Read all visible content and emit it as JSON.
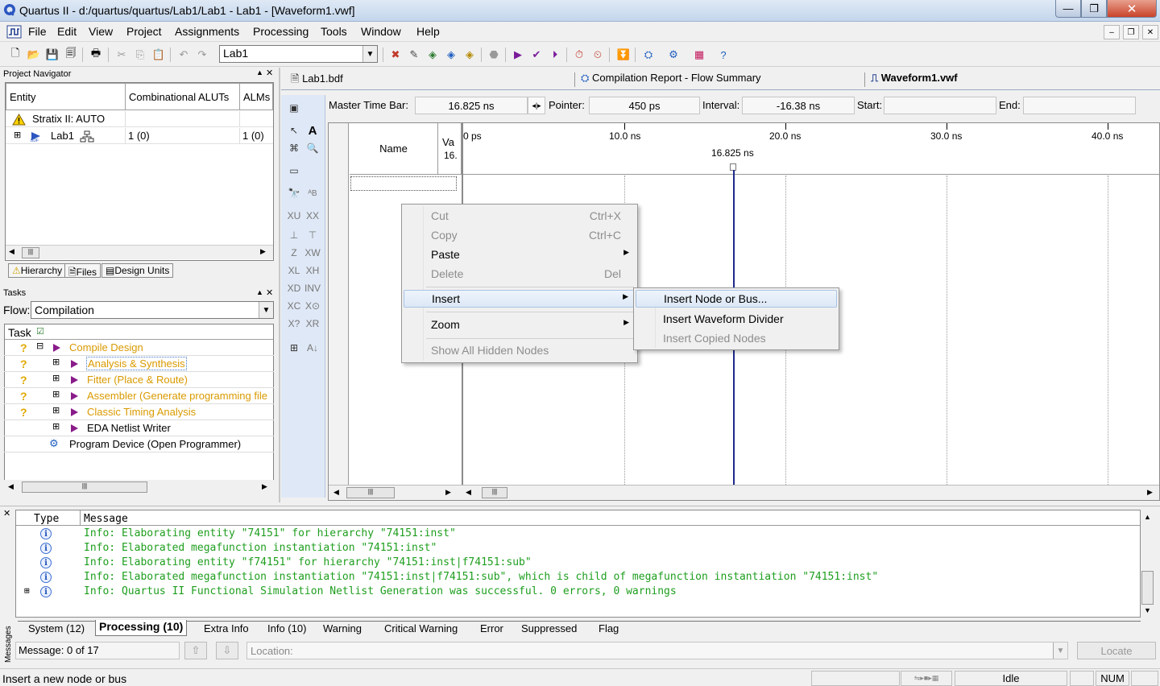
{
  "window": {
    "title": "Quartus II - d:/quartus/quartus/Lab1/Lab1 - Lab1 - [Waveform1.vwf]",
    "minimize": "—",
    "maximize": "❐",
    "close": "✕"
  },
  "menu": {
    "items": [
      "File",
      "Edit",
      "View",
      "Project",
      "Assignments",
      "Processing",
      "Tools",
      "Window",
      "Help"
    ],
    "mdi_min": "–",
    "mdi_restore": "❐",
    "mdi_close": "✕"
  },
  "toolbar": {
    "project_combo": "Lab1"
  },
  "project_navigator": {
    "title": "Project Navigator",
    "columns": [
      "Entity",
      "Combinational ALUTs",
      "ALMs"
    ],
    "rows": [
      {
        "entity": "Stratix II: AUTO",
        "aluts": "",
        "alms": ""
      },
      {
        "entity": "Lab1",
        "aluts": "1 (0)",
        "alms": "1 (0)"
      }
    ],
    "tabs": [
      "Hierarchy",
      "Files",
      "Design Units"
    ]
  },
  "tasks": {
    "title": "Tasks",
    "flow_label": "Flow:",
    "flow_value": "Compilation",
    "column": "Task",
    "items": [
      "Compile Design",
      "Analysis & Synthesis",
      "Fitter (Place & Route)",
      "Assembler (Generate programming file",
      "Classic Timing Analysis",
      "EDA Netlist Writer",
      "Program Device (Open Programmer)"
    ]
  },
  "doc_tabs": [
    "Lab1.bdf",
    "Compilation Report - Flow Summary",
    "Waveform1.vwf"
  ],
  "time_bar": {
    "master_label": "Master Time Bar:",
    "master_value": "16.825 ns",
    "pointer_label": "Pointer:",
    "pointer_value": "450 ps",
    "interval_label": "Interval:",
    "interval_value": "-16.38 ns",
    "start_label": "Start:",
    "start_value": "",
    "end_label": "End:",
    "end_value": ""
  },
  "waveform": {
    "name_header": "Name",
    "value_header": "Va",
    "value_sub": "16.",
    "time_labels": [
      "0 ps",
      "10.0 ns",
      "20.0 ns",
      "30.0 ns",
      "40.0 ns"
    ],
    "cursor_label": "16.825 ns"
  },
  "context_menu": {
    "cut": "Cut",
    "cut_sc": "Ctrl+X",
    "copy": "Copy",
    "copy_sc": "Ctrl+C",
    "paste": "Paste",
    "delete": "Delete",
    "delete_sc": "Del",
    "insert": "Insert",
    "zoom": "Zoom",
    "show_hidden": "Show All Hidden Nodes"
  },
  "insert_submenu": {
    "node_or_bus": "Insert Node or Bus...",
    "divider": "Insert Waveform Divider",
    "copied": "Insert Copied Nodes"
  },
  "messages": {
    "col_type": "Type",
    "col_message": "Message",
    "lines": [
      "Info: Elaborating entity \"74151\" for hierarchy \"74151:inst\"",
      "Info: Elaborated megafunction instantiation \"74151:inst\"",
      "Info: Elaborating entity \"f74151\" for hierarchy \"74151:inst|f74151:sub\"",
      "Info: Elaborated megafunction instantiation \"74151:inst|f74151:sub\", which is child of megafunction instantiation \"74151:inst\"",
      "Info: Quartus II Functional Simulation Netlist Generation was successful. 0 errors, 0 warnings"
    ],
    "tabs": [
      "System (12)",
      "Processing (10)",
      "Extra Info",
      "Info (10)",
      "Warning",
      "Critical Warning",
      "Error",
      "Suppressed",
      "Flag"
    ],
    "side_label": "Messages",
    "count": "Message: 0 of 17",
    "location_placeholder": "Location:",
    "locate": "Locate"
  },
  "status": {
    "hint": "Insert a new node or bus",
    "state": "Idle",
    "num": "NUM"
  }
}
